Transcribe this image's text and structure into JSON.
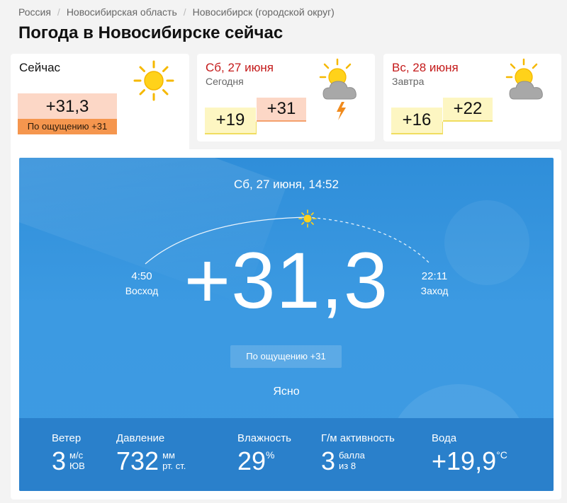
{
  "breadcrumb": [
    "Россия",
    "Новосибирская область",
    "Новосибирск (городской округ)"
  ],
  "page_title": "Погода в Новосибирске сейчас",
  "now_card": {
    "label": "Сейчас",
    "temp": "+31,3",
    "feels": "По ощущению +31",
    "icon": "sun-icon"
  },
  "forecast": [
    {
      "date": "Сб, 27 июня",
      "sub": "Сегодня",
      "min": "+19",
      "max": "+31",
      "icon": "sun-cloud-thunder-icon"
    },
    {
      "date": "Вс, 28 июня",
      "sub": "Завтра",
      "min": "+16",
      "max": "+22",
      "icon": "sun-cloud-icon"
    }
  ],
  "current": {
    "datetime": "Сб, 27 июня, 14:52",
    "sunrise_time": "4:50",
    "sunrise_label": "Восход",
    "sunset_time": "22:11",
    "sunset_label": "Заход",
    "temp": "+31,3",
    "feels": "По ощущению +31",
    "condition": "Ясно"
  },
  "stats": {
    "wind": {
      "label": "Ветер",
      "value": "3",
      "unit1": "м/с",
      "unit2": "ЮВ"
    },
    "pressure": {
      "label": "Давление",
      "value": "732",
      "unit1": "мм",
      "unit2": "рт. ст."
    },
    "humidity": {
      "label": "Влажность",
      "value": "29",
      "unit": "%"
    },
    "geomag": {
      "label": "Г/м активность",
      "value": "3",
      "unit1": "балла",
      "unit2": "из 8"
    },
    "water": {
      "label": "Вода",
      "value": "+19,9",
      "unit": "°C"
    }
  },
  "colors": {
    "accent_red": "#c41a1a",
    "sky_blue": "#3c9ae2",
    "stats_blue": "#2a80cb",
    "warm_box": "#fcd7c6",
    "feels_orange": "#f5964e",
    "cool_box": "#fdf6c2"
  }
}
